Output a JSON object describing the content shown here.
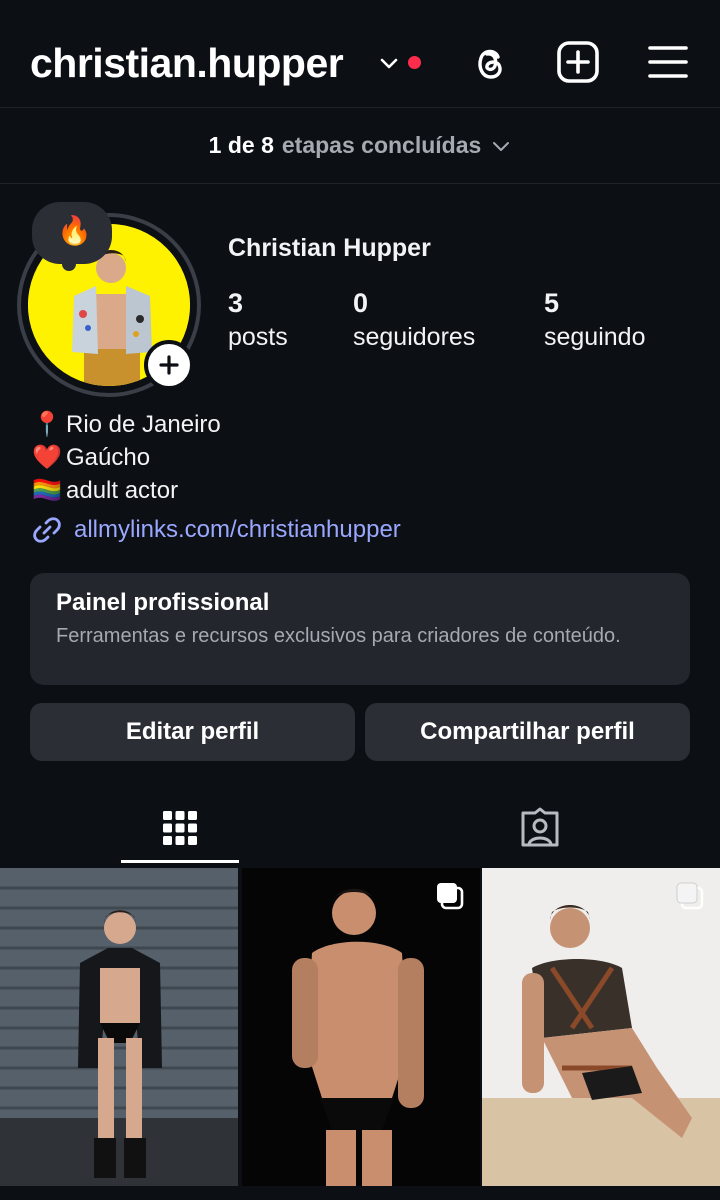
{
  "header": {
    "username": "christian.hupper",
    "icons": [
      "chevron-down-icon",
      "threads-icon",
      "add-post-icon",
      "menu-icon"
    ],
    "notification_color": "#ff2d4b"
  },
  "steps": {
    "count": "1 de 8",
    "label": "etapas concluídas"
  },
  "profile": {
    "note_emoji": "🔥",
    "full_name": "Christian Hupper",
    "stats": [
      {
        "value": "3",
        "label": "posts"
      },
      {
        "value": "0",
        "label": "seguidores"
      },
      {
        "value": "5",
        "label": "seguindo"
      }
    ],
    "bio": [
      {
        "emoji": "📍",
        "text": "Rio de Janeiro"
      },
      {
        "emoji": "❤️",
        "text": "Gaúcho"
      },
      {
        "emoji": "🏳️‍🌈",
        "text": "adult actor"
      }
    ],
    "link": "allmylinks.com/christianhupper",
    "link_color": "#9aa7ff"
  },
  "pro_panel": {
    "title": "Painel profissional",
    "description": "Ferramentas e recursos exclusivos para criadores de conteúdo."
  },
  "buttons": {
    "edit": "Editar perfil",
    "share": "Compartilhar perfil"
  },
  "tabs": [
    {
      "icon": "grid-icon",
      "active": true
    },
    {
      "icon": "tagged-icon",
      "active": false
    }
  ],
  "posts": [
    {
      "icon": "photo",
      "multiple": false
    },
    {
      "icon": "photo",
      "multiple": true
    },
    {
      "icon": "photo",
      "multiple": true
    }
  ]
}
